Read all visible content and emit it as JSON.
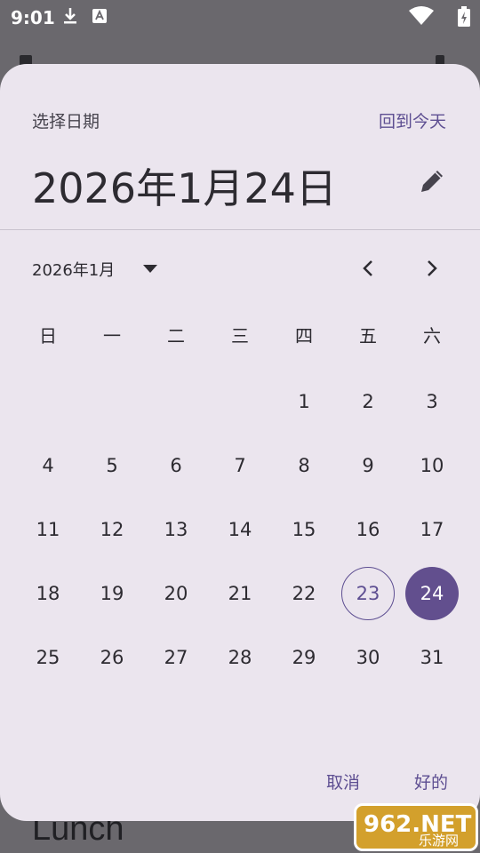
{
  "status_bar": {
    "time": "9:01",
    "icons": [
      "download-icon",
      "a11y-icon",
      "wifi-icon",
      "battery-charging-icon"
    ]
  },
  "background": {
    "lunch_label": "Lunch"
  },
  "dialog": {
    "label": "选择日期",
    "today_button": "回到今天",
    "selected_date": "2026年1月24日",
    "month_selector": "2026年1月",
    "weekdays": [
      "日",
      "一",
      "二",
      "三",
      "四",
      "五",
      "六"
    ],
    "weeks": [
      [
        "",
        "",
        "",
        "",
        "1",
        "2",
        "3"
      ],
      [
        "4",
        "5",
        "6",
        "7",
        "8",
        "9",
        "10"
      ],
      [
        "11",
        "12",
        "13",
        "14",
        "15",
        "16",
        "17"
      ],
      [
        "18",
        "19",
        "20",
        "21",
        "22",
        "23",
        "24"
      ],
      [
        "25",
        "26",
        "27",
        "28",
        "29",
        "30",
        "31"
      ]
    ],
    "today_day": "23",
    "selected_day": "24",
    "cancel_button": "取消",
    "ok_button": "好的"
  },
  "watermark": {
    "brand_number": "962.NET",
    "brand_text": "乐游网"
  },
  "colors": {
    "accent": "#5e4f92",
    "selected_fill": "#624f8e",
    "dialog_bg": "#ebe5ee"
  }
}
